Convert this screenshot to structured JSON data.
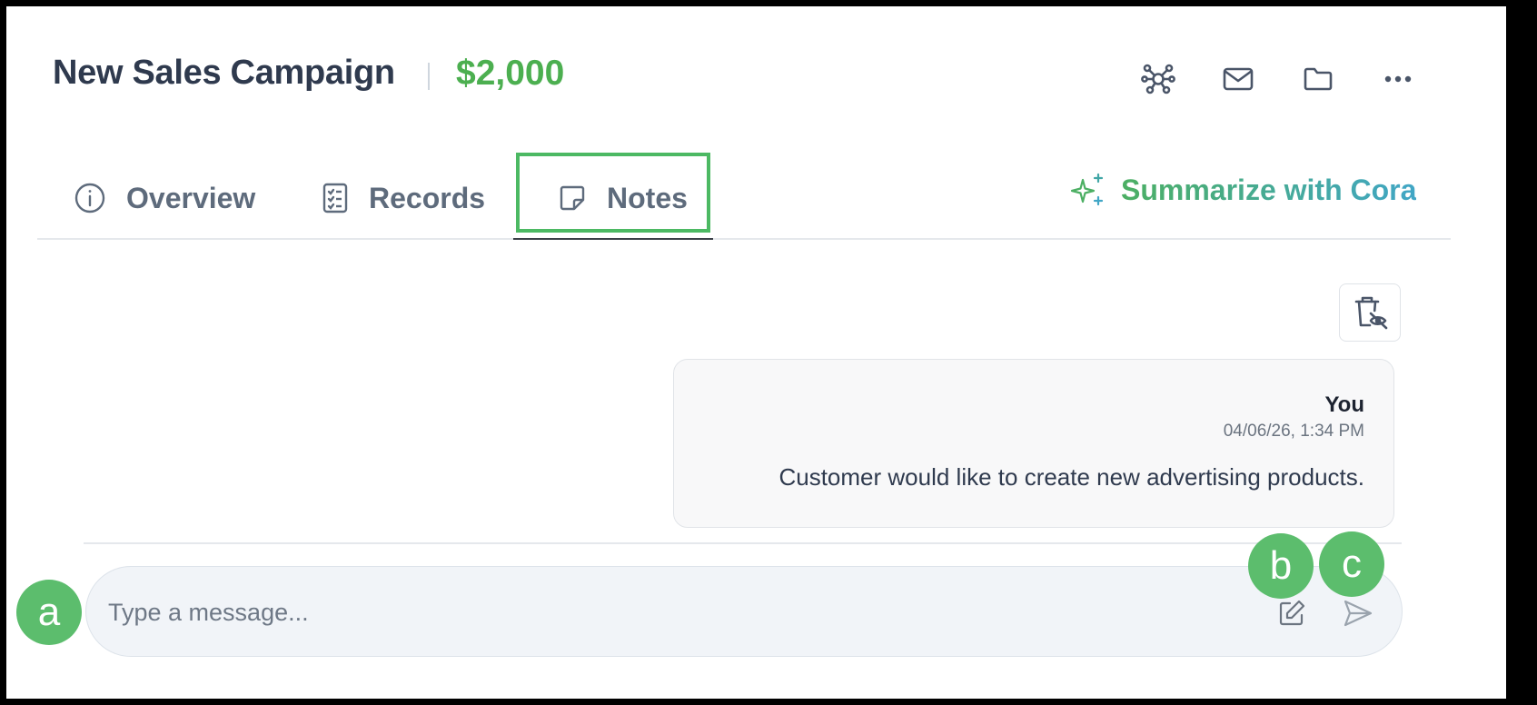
{
  "header": {
    "title": "New Sales Campaign",
    "amount": "$2,000",
    "actions": [
      "network-icon",
      "mail-icon",
      "folder-icon",
      "more-icon"
    ]
  },
  "tabs": [
    {
      "label": "Overview",
      "icon": "info-icon",
      "active": false
    },
    {
      "label": "Records",
      "icon": "checklist-icon",
      "active": false
    },
    {
      "label": "Notes",
      "icon": "note-icon",
      "active": true
    }
  ],
  "summarize": {
    "label": "Summarize with Cora",
    "icon": "sparkle-icon"
  },
  "notes": [
    {
      "author": "You",
      "timestamp": "04/06/26, 1:34 PM",
      "text": "Customer would like to create new advertising products."
    }
  ],
  "composer": {
    "placeholder": "Type a message...",
    "value": ""
  },
  "markers": {
    "a": "a",
    "b": "b",
    "c": "c"
  },
  "colors": {
    "accent": "#4caf50",
    "highlight": "#4cb963",
    "marker": "#5cbd6d",
    "text": "#2f3a4e"
  }
}
